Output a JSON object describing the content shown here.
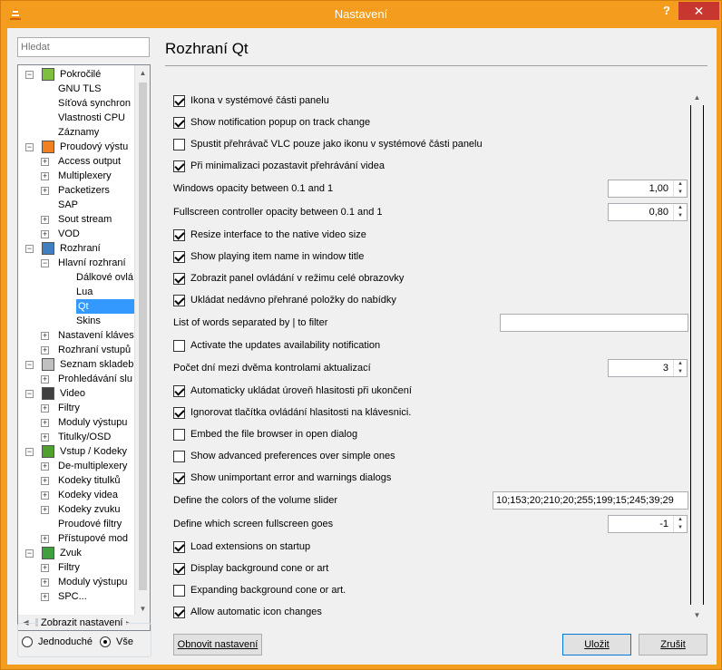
{
  "window": {
    "title": "Nastavení",
    "help_label": "?",
    "close_label": "✕"
  },
  "search": {
    "placeholder": "Hledat"
  },
  "tree": {
    "items": [
      {
        "label": "Pokročilé",
        "icon": "advanced-chip-icon"
      },
      {
        "label": "GNU TLS"
      },
      {
        "label": "Síťová synchron"
      },
      {
        "label": "Vlastnosti CPU"
      },
      {
        "label": "Záznamy"
      },
      {
        "label": "Proudový výstu",
        "icon": "stream-output-icon"
      },
      {
        "label": "Access output"
      },
      {
        "label": "Multiplexery"
      },
      {
        "label": "Packetizers"
      },
      {
        "label": "SAP"
      },
      {
        "label": "Sout stream"
      },
      {
        "label": "VOD"
      },
      {
        "label": "Rozhraní",
        "icon": "interface-icon"
      },
      {
        "label": "Hlavní rozhraní"
      },
      {
        "label": "Dálkové ovlá"
      },
      {
        "label": "Lua"
      },
      {
        "label": "Qt"
      },
      {
        "label": "Skins"
      },
      {
        "label": "Nastavení kláves"
      },
      {
        "label": "Rozhraní vstupů"
      },
      {
        "label": "Seznam skladeb",
        "icon": "playlist-icon"
      },
      {
        "label": "Prohledávání slu"
      },
      {
        "label": "Video",
        "icon": "video-film-icon"
      },
      {
        "label": "Filtry"
      },
      {
        "label": "Moduly výstupu"
      },
      {
        "label": "Titulky/OSD"
      },
      {
        "label": "Vstup / Kodeky",
        "icon": "input-codecs-icon"
      },
      {
        "label": "De-multiplexery"
      },
      {
        "label": "Kodeky titulků"
      },
      {
        "label": "Kodeky videa"
      },
      {
        "label": "Kodeky zvuku"
      },
      {
        "label": "Proudové filtry"
      },
      {
        "label": "Přístupové mod"
      },
      {
        "label": "Zvuk",
        "icon": "audio-note-icon"
      },
      {
        "label": "Filtry"
      },
      {
        "label": "Moduly výstupu"
      },
      {
        "label": "SPC..."
      }
    ]
  },
  "view_mode": {
    "title": "Zobrazit nastavení",
    "simple_label": "Jednoduché",
    "all_label": "Vše",
    "selected": "Vše"
  },
  "page": {
    "title": "Rozhraní Qt",
    "settings": [
      {
        "label": "Ikona v systémové části panelu",
        "checked": true
      },
      {
        "label": "Show notification popup on track change",
        "checked": true
      },
      {
        "label": "Spustit přehrávač VLC pouze jako ikonu v systémové části panelu",
        "checked": false
      },
      {
        "label": "Při minimalizaci pozastavit přehrávání videa",
        "checked": true
      },
      {
        "label": "Windows opacity between 0.1 and 1",
        "value": "1,00"
      },
      {
        "label": "Fullscreen controller opacity between 0.1 and 1",
        "value": "0,80"
      },
      {
        "label": "Resize interface to the native video size",
        "checked": true
      },
      {
        "label": "Show playing item name in window title",
        "checked": true
      },
      {
        "label": "Zobrazit panel ovládání v režimu celé obrazovky",
        "checked": true
      },
      {
        "label": "Ukládat nedávno přehrané položky do nabídky",
        "checked": true
      },
      {
        "label": "List of words separated by | to filter",
        "value": ""
      },
      {
        "label": "Activate the updates availability notification",
        "checked": false
      },
      {
        "label": "Počet dní mezi dvěma kontrolami aktualizací",
        "value": "3"
      },
      {
        "label": "Automaticky ukládat úroveň hlasitosti při ukončení",
        "checked": true
      },
      {
        "label": "Ignorovat tlačítka ovládání hlasitosti na klávesnici.",
        "checked": true
      },
      {
        "label": "Embed the file browser in open dialog",
        "checked": false
      },
      {
        "label": "Show advanced preferences over simple ones",
        "checked": false
      },
      {
        "label": "Show unimportant error and warnings dialogs",
        "checked": true
      },
      {
        "label": "Define the colors of the volume slider",
        "value": "10;153;20;210;20;255;199;15;245;39;29"
      },
      {
        "label": "Define which screen fullscreen goes",
        "value": "-1"
      },
      {
        "label": "Load extensions on startup",
        "checked": true
      },
      {
        "label": "Display background cone or art",
        "checked": true
      },
      {
        "label": "Expanding background cone or art.",
        "checked": false
      },
      {
        "label": "Allow automatic icon changes",
        "checked": true
      }
    ]
  },
  "buttons": {
    "reset": "Obnovit nastavení",
    "save": "Uložit",
    "cancel": "Zrušit"
  },
  "colors": {
    "titlebar": "#f39c1e",
    "close": "#c7372f",
    "selection": "#3399ff"
  }
}
